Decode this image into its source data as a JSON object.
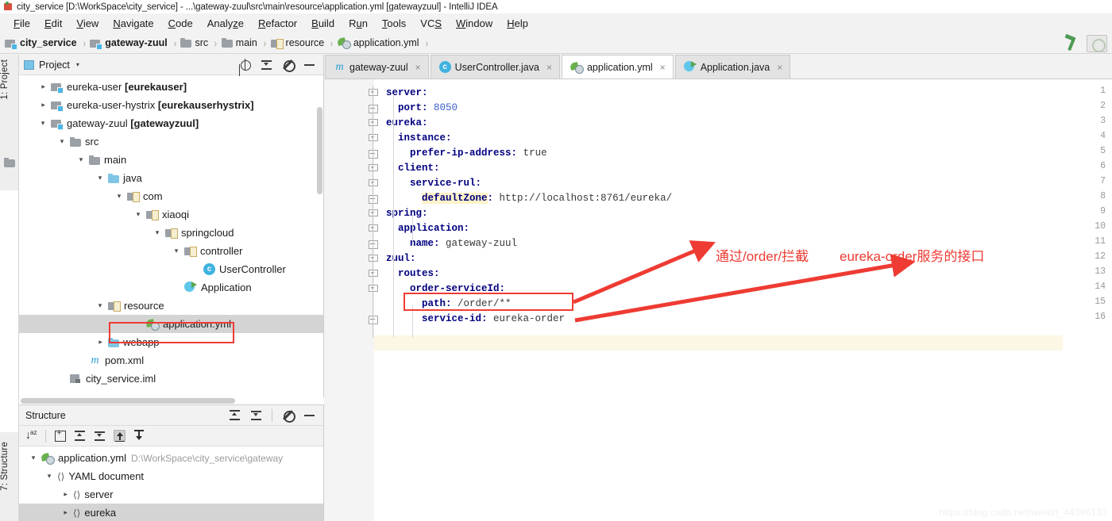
{
  "window": {
    "title": "city_service [D:\\WorkSpace\\city_service] - ...\\gateway-zuul\\src\\main\\resource\\application.yml [gatewayzuul] - IntelliJ IDEA",
    "app_icon": "intellij-idea-icon"
  },
  "menubar": {
    "items": [
      {
        "label": "File",
        "mnemonic": "F"
      },
      {
        "label": "Edit",
        "mnemonic": "E"
      },
      {
        "label": "View",
        "mnemonic": "V"
      },
      {
        "label": "Navigate",
        "mnemonic": "N"
      },
      {
        "label": "Code",
        "mnemonic": "C"
      },
      {
        "label": "Analyze",
        "mnemonic": "z"
      },
      {
        "label": "Refactor",
        "mnemonic": "R"
      },
      {
        "label": "Build",
        "mnemonic": "B"
      },
      {
        "label": "Run",
        "mnemonic": "u"
      },
      {
        "label": "Tools",
        "mnemonic": "T"
      },
      {
        "label": "VCS",
        "mnemonic": "S"
      },
      {
        "label": "Window",
        "mnemonic": "W"
      },
      {
        "label": "Help",
        "mnemonic": "H"
      }
    ]
  },
  "breadcrumb": {
    "items": [
      {
        "label": "city_service",
        "icon": "module-icon",
        "bold": true
      },
      {
        "label": "gateway-zuul",
        "icon": "module-icon",
        "bold": true
      },
      {
        "label": "src",
        "icon": "folder-icon",
        "bold": false
      },
      {
        "label": "main",
        "icon": "folder-icon",
        "bold": false
      },
      {
        "label": "resource",
        "icon": "resource-folder-icon",
        "bold": false
      },
      {
        "label": "application.yml",
        "icon": "yaml-file-icon",
        "bold": false
      }
    ],
    "separator": "›"
  },
  "toolbar_right": {
    "build_icon": "hammer-icon",
    "run_icon": "run-config-icon"
  },
  "tool_strips": {
    "left_top": "1: Project",
    "left_bottom": "7: Structure"
  },
  "project_panel": {
    "title": "Project",
    "caret": "▾",
    "actions": [
      "scroll-from-source-icon",
      "collapse-all-icon",
      "settings-gear-icon",
      "hide-icon"
    ],
    "tree": [
      {
        "indent": 1,
        "twisty": "right",
        "icon": "module-icon",
        "label": "eureka-user ",
        "bold_suffix": "[eurekauser]",
        "selected": false
      },
      {
        "indent": 1,
        "twisty": "right",
        "icon": "module-icon",
        "label": "eureka-user-hystrix ",
        "bold_suffix": "[eurekauserhystrix]",
        "selected": false
      },
      {
        "indent": 1,
        "twisty": "down",
        "icon": "module-icon",
        "label": "gateway-zuul ",
        "bold_suffix": "[gatewayzuul]",
        "selected": false
      },
      {
        "indent": 2,
        "twisty": "down",
        "icon": "folder-icon",
        "label": "src",
        "bold_suffix": "",
        "selected": false
      },
      {
        "indent": 3,
        "twisty": "down",
        "icon": "folder-icon",
        "label": "main",
        "bold_suffix": "",
        "selected": false
      },
      {
        "indent": 4,
        "twisty": "down",
        "icon": "source-folder-icon",
        "label": "java",
        "bold_suffix": "",
        "selected": false
      },
      {
        "indent": 5,
        "twisty": "down",
        "icon": "package-icon",
        "label": "com",
        "bold_suffix": "",
        "selected": false
      },
      {
        "indent": 6,
        "twisty": "down",
        "icon": "package-icon",
        "label": "xiaoqi",
        "bold_suffix": "",
        "selected": false
      },
      {
        "indent": 7,
        "twisty": "down",
        "icon": "package-icon",
        "label": "springcloud",
        "bold_suffix": "",
        "selected": false
      },
      {
        "indent": 8,
        "twisty": "down",
        "icon": "package-icon",
        "label": "controller",
        "bold_suffix": "",
        "selected": false
      },
      {
        "indent": 9,
        "twisty": "none",
        "icon": "java-class-icon",
        "label": "UserController",
        "bold_suffix": "",
        "selected": false
      },
      {
        "indent": 8,
        "twisty": "none",
        "icon": "java-runnable-class-icon",
        "label": "Application",
        "bold_suffix": "",
        "selected": false
      },
      {
        "indent": 4,
        "twisty": "down",
        "icon": "resource-folder-icon",
        "label": "resource",
        "bold_suffix": "",
        "selected": false
      },
      {
        "indent": 5,
        "twisty": "none",
        "icon": "yaml-file-icon",
        "label": "application.yml",
        "bold_suffix": "",
        "selected": true
      },
      {
        "indent": 4,
        "twisty": "right",
        "icon": "webapp-folder-icon",
        "label": "webapp",
        "bold_suffix": "",
        "selected": false
      },
      {
        "indent": 3,
        "twisty": "none",
        "icon": "maven-pom-icon",
        "label": "pom.xml",
        "bold_suffix": "",
        "selected": false
      },
      {
        "indent": 2,
        "twisty": "none",
        "icon": "iml-file-icon",
        "label": "city_service.iml",
        "bold_suffix": "",
        "selected": false
      }
    ]
  },
  "structure_panel": {
    "title": "Structure",
    "header_actions": [
      "expand-all-icon",
      "collapse-all-icon",
      "settings-gear-icon",
      "hide-icon"
    ],
    "toolbar_actions": [
      "sort-alphabetically-icon",
      "show-properties-icon",
      "expand-all-icon",
      "collapse-all-icon",
      "autoscroll-to-source-icon",
      "autoscroll-from-source-icon"
    ],
    "tree": [
      {
        "indent": 0,
        "twisty": "down",
        "icon": "yaml-file-icon",
        "label": "application.yml",
        "path": "D:\\WorkSpace\\city_service\\gateway",
        "selected": false
      },
      {
        "indent": 1,
        "twisty": "down",
        "icon": "yaml-tag-icon",
        "label": "YAML document",
        "path": "",
        "selected": false
      },
      {
        "indent": 2,
        "twisty": "right",
        "icon": "yaml-tag-icon",
        "label": "server",
        "path": "",
        "selected": false
      },
      {
        "indent": 2,
        "twisty": "right",
        "icon": "yaml-tag-icon",
        "label": "eureka",
        "path": "",
        "selected": true
      }
    ]
  },
  "editor": {
    "tabs": [
      {
        "label": "gateway-zuul",
        "icon": "maven-pom-icon",
        "active": false,
        "close": "×"
      },
      {
        "label": "UserController.java",
        "icon": "java-class-icon",
        "active": false,
        "close": "×"
      },
      {
        "label": "application.yml",
        "icon": "yaml-file-icon",
        "active": true,
        "close": "×"
      },
      {
        "label": "Application.java",
        "icon": "java-runnable-class-icon",
        "active": false,
        "close": "×"
      }
    ],
    "language": "yaml",
    "lines": [
      {
        "n": 1,
        "indent": 0,
        "fold": "open",
        "key": "server",
        "sep": ":",
        "value": "",
        "value_kind": "none",
        "highlight_key": false,
        "row_highlight": false
      },
      {
        "n": 2,
        "indent": 1,
        "fold": "closed",
        "key": "port",
        "sep": ":",
        "value": "8050",
        "value_kind": "number",
        "highlight_key": false,
        "row_highlight": false
      },
      {
        "n": 3,
        "indent": 0,
        "fold": "open",
        "key": "eureka",
        "sep": ":",
        "value": "",
        "value_kind": "none",
        "highlight_key": false,
        "row_highlight": false
      },
      {
        "n": 4,
        "indent": 1,
        "fold": "open",
        "key": "instance",
        "sep": ":",
        "value": "",
        "value_kind": "none",
        "highlight_key": false,
        "row_highlight": false
      },
      {
        "n": 5,
        "indent": 2,
        "fold": "closed",
        "key": "prefer-ip-address",
        "sep": ":",
        "value": "true",
        "value_kind": "text",
        "highlight_key": false,
        "row_highlight": false
      },
      {
        "n": 6,
        "indent": 1,
        "fold": "open",
        "key": "client",
        "sep": ":",
        "value": "",
        "value_kind": "none",
        "highlight_key": false,
        "row_highlight": false
      },
      {
        "n": 7,
        "indent": 2,
        "fold": "open",
        "key": "service-rul",
        "sep": ":",
        "value": "",
        "value_kind": "none",
        "highlight_key": false,
        "row_highlight": false
      },
      {
        "n": 8,
        "indent": 3,
        "fold": "closed",
        "key": "defaultZone",
        "sep": ":",
        "value": "http://localhost:8761/eureka/",
        "value_kind": "text",
        "highlight_key": true,
        "row_highlight": false
      },
      {
        "n": 9,
        "indent": 0,
        "fold": "open",
        "key": "spring",
        "sep": ":",
        "value": "",
        "value_kind": "none",
        "highlight_key": false,
        "row_highlight": false
      },
      {
        "n": 10,
        "indent": 1,
        "fold": "open",
        "key": "application",
        "sep": ":",
        "value": "",
        "value_kind": "none",
        "highlight_key": false,
        "row_highlight": false
      },
      {
        "n": 11,
        "indent": 2,
        "fold": "closed",
        "key": "name",
        "sep": ":",
        "value": "gateway-zuul",
        "value_kind": "text",
        "highlight_key": false,
        "row_highlight": false
      },
      {
        "n": 12,
        "indent": 0,
        "fold": "open",
        "key": "zuul",
        "sep": ":",
        "value": "",
        "value_kind": "none",
        "highlight_key": false,
        "row_highlight": false
      },
      {
        "n": 13,
        "indent": 1,
        "fold": "open",
        "key": "routes",
        "sep": ":",
        "value": "",
        "value_kind": "none",
        "highlight_key": false,
        "row_highlight": false
      },
      {
        "n": 14,
        "indent": 2,
        "fold": "open",
        "key": "order-serviceId",
        "sep": ":",
        "value": "",
        "value_kind": "none",
        "highlight_key": false,
        "row_highlight": false
      },
      {
        "n": 15,
        "indent": 3,
        "fold": "none",
        "key": "path",
        "sep": ":",
        "value": "/order/**",
        "value_kind": "text",
        "highlight_key": false,
        "row_highlight": false
      },
      {
        "n": 16,
        "indent": 3,
        "fold": "closed",
        "key": "service-id",
        "sep": ":",
        "value": "eureka-order",
        "value_kind": "text",
        "highlight_key": false,
        "row_highlight": true
      }
    ]
  },
  "annotations": {
    "color": "#ee3b33",
    "labels": [
      {
        "text": "通过/order/拦截"
      },
      {
        "text": "eureka-order服务的接口"
      }
    ],
    "highlight_boxes": [
      "code-path-line-box",
      "tree-application-yml-box"
    ],
    "arrows": [
      "arrow-to-path-label",
      "arrow-to-service-id-label"
    ]
  },
  "watermark": {
    "text": "https://blog.csdn.net/weixin_44096133"
  }
}
